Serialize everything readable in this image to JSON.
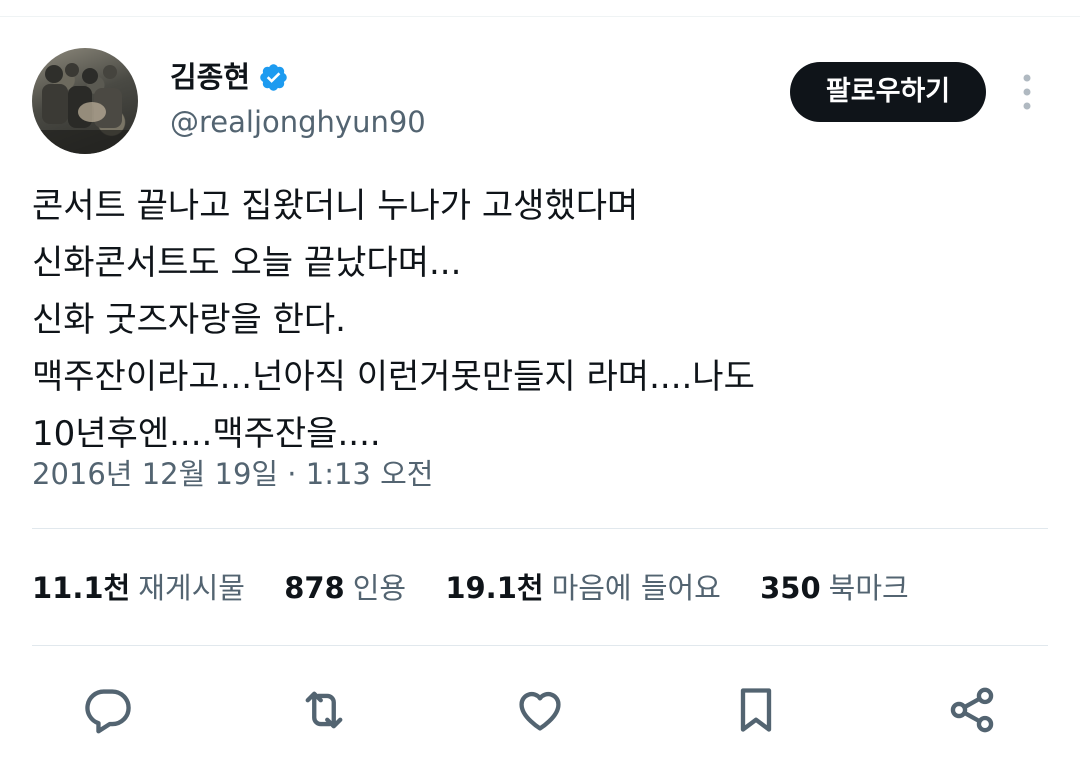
{
  "author": {
    "display_name": "김종현",
    "handle": "@realjonghyun90"
  },
  "header": {
    "follow_label": "팔로우하기",
    "verified_color": "#1d9bf0"
  },
  "tweet": {
    "lines": [
      "콘서트 끝나고 집왔더니 누나가 고생했다며",
      "신화콘서트도 오늘 끝났다며...",
      "신화 굿즈자랑을 한다.",
      "맥주잔이라고...넌아직 이런거못만들지 라며....나도",
      "10년후엔....맥주잔을...."
    ],
    "timestamp": "2016년 12월 19일 · 1:13 오전"
  },
  "stats": {
    "retweets": {
      "value": "11.1천",
      "label": "재게시물"
    },
    "quotes": {
      "value": "878",
      "label": "인용"
    },
    "likes": {
      "value": "19.1천",
      "label": "마음에 들어요"
    },
    "bookmarks": {
      "value": "350",
      "label": "북마크"
    }
  },
  "actions": [
    "reply-icon",
    "retweet-icon",
    "like-icon",
    "bookmark-icon",
    "share-icon"
  ]
}
